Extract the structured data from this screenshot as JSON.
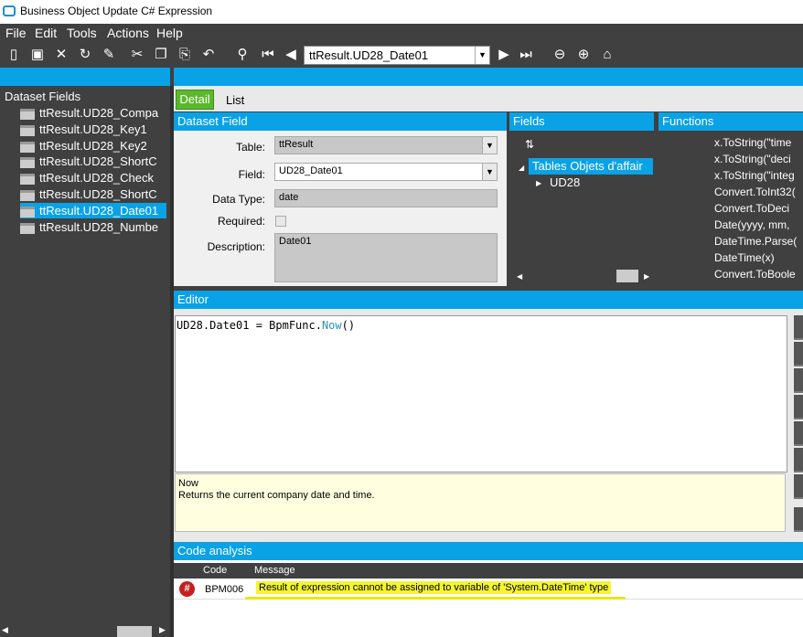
{
  "window": {
    "title": "Business Object Update C# Expression"
  },
  "menu": [
    "File",
    "Edit",
    "Tools",
    "Actions",
    "Help"
  ],
  "toolbar": {
    "icons": [
      "new-icon",
      "save-icon",
      "delete-icon",
      "refresh-icon",
      "clear-icon",
      "cut-icon",
      "copy-icon",
      "paste-icon",
      "undo-icon",
      "find-icon",
      "first-record-icon",
      "previous-record-icon",
      "next-record-icon",
      "last-record-icon",
      "back-icon",
      "forward-icon",
      "home-icon"
    ],
    "nav_value": "ttResult.UD28_Date01"
  },
  "left_panel": {
    "header": "Dataset Fields",
    "items": [
      {
        "label": "ttResult.UD28_Compa",
        "selected": false
      },
      {
        "label": "ttResult.UD28_Key1",
        "selected": false
      },
      {
        "label": "ttResult.UD28_Key2",
        "selected": false
      },
      {
        "label": "ttResult.UD28_ShortC",
        "selected": false
      },
      {
        "label": "ttResult.UD28_Check",
        "selected": false
      },
      {
        "label": "ttResult.UD28_ShortC",
        "selected": false
      },
      {
        "label": "ttResult.UD28_Date01",
        "selected": true
      },
      {
        "label": "ttResult.UD28_Numbe",
        "selected": false
      }
    ]
  },
  "tabs": {
    "detail": "Detail",
    "list": "List"
  },
  "dataset_field": {
    "header": "Dataset Field",
    "table_label": "Table:",
    "table_value": "ttResult",
    "field_label": "Field:",
    "field_value": "UD28_Date01",
    "datatype_label": "Data Type:",
    "datatype_value": "date",
    "required_label": "Required:",
    "description_label": "Description:",
    "description_value": "Date01"
  },
  "fields_panel": {
    "header": "Fields",
    "root": "Tables Objets d'affair",
    "child": "UD28"
  },
  "functions_panel": {
    "header": "Functions",
    "items": [
      "x.ToString(\"time",
      "x.ToString(\"deci",
      "x.ToString(\"integ",
      "Convert.ToInt32(",
      "Convert.ToDeci",
      "Date(yyyy, mm,",
      "DateTime.Parse(",
      "DateTime(x)",
      "Convert.ToBoole"
    ]
  },
  "editor": {
    "header": "Editor",
    "code_prefix": "UD28.Date01 = BpmFunc.",
    "code_fn": "Now",
    "code_suffix": "()"
  },
  "help": {
    "title": "Now",
    "text": "Returns the current company date and time."
  },
  "code_analysis": {
    "header": "Code analysis",
    "col_code": "Code",
    "col_message": "Message",
    "row_icon": "#",
    "row_code": "BPM006",
    "row_message": "Result of expression cannot be assigned to variable of 'System.DateTime' type"
  },
  "colors": {
    "accent": "#0aa2e6",
    "tab_active": "#5ab82d",
    "error": "#c51f1f",
    "highlight": "#f4f431"
  }
}
